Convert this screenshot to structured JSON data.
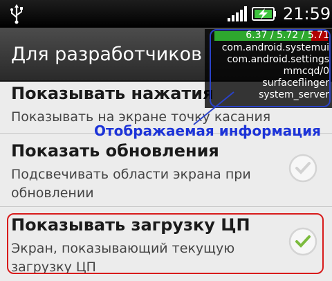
{
  "status_bar": {
    "time": "21:59",
    "icons": [
      "usb-icon",
      "signal-icon",
      "battery-charging-icon"
    ]
  },
  "action_bar": {
    "title": "Для разработчиков"
  },
  "settings": [
    {
      "title": "Показывать нажатия",
      "subtitle": "Показывать на экране точку касания",
      "checked": false
    },
    {
      "title": "Показать обновления",
      "subtitle": "Подсвечивать области экрана при обновлении",
      "checked": false
    },
    {
      "title": "Показывать загрузку ЦП",
      "subtitle": "Экран, показывающий текущую загрузку ЦП",
      "checked": true
    }
  ],
  "cpu_overlay": {
    "load_averages": "6.37 / 5.72 / 5.71",
    "processes": [
      "com.android.systemui",
      "com.android.settings",
      "mmcqd/0",
      "surfaceflinger",
      "system_server"
    ]
  },
  "annotation": {
    "label": "Отображаемая информация",
    "color": "#1c33d8",
    "highlight_color": "#d81b1b"
  }
}
